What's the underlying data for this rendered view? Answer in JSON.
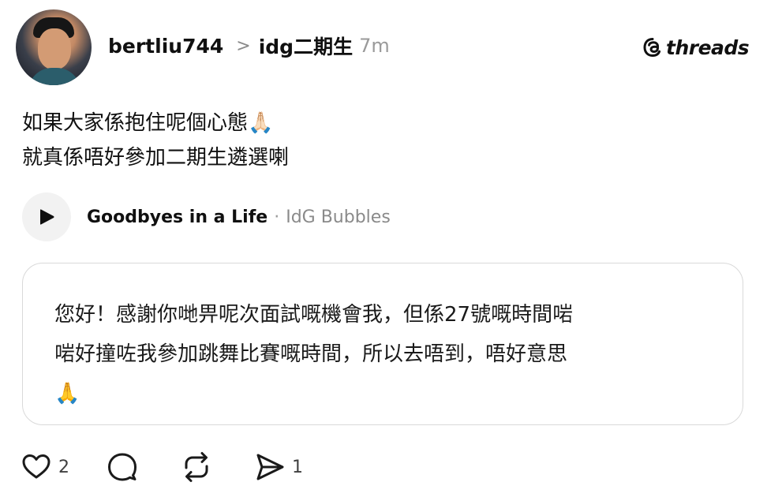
{
  "header": {
    "username": "bertliu744",
    "separator": ">",
    "group": "idg二期生",
    "time": "7m"
  },
  "brand": {
    "wordmark": "threads",
    "icon": "threads-logo-icon"
  },
  "post": {
    "lines": [
      "如果大家係抱住呢個心態🙏🏻",
      "就真係唔好參加二期生遴選喇"
    ]
  },
  "music": {
    "icon": "play-icon",
    "title": "Goodbyes in a Life",
    "separator": "·",
    "artist": "IdG Bubbles"
  },
  "quoted_message": {
    "lines": [
      "您好！感謝你哋畀呢次面試嘅機會我，但係27號嘅時間啱",
      "啱好撞咗我參加跳舞比賽嘅時間，所以去唔到，唔好意思",
      "🙏"
    ]
  },
  "actions": {
    "like": {
      "icon": "heart-icon",
      "count": "2"
    },
    "reply": {
      "icon": "comment-icon",
      "count": ""
    },
    "repost": {
      "icon": "repost-icon",
      "count": ""
    },
    "share": {
      "icon": "send-icon",
      "count": "1"
    }
  }
}
